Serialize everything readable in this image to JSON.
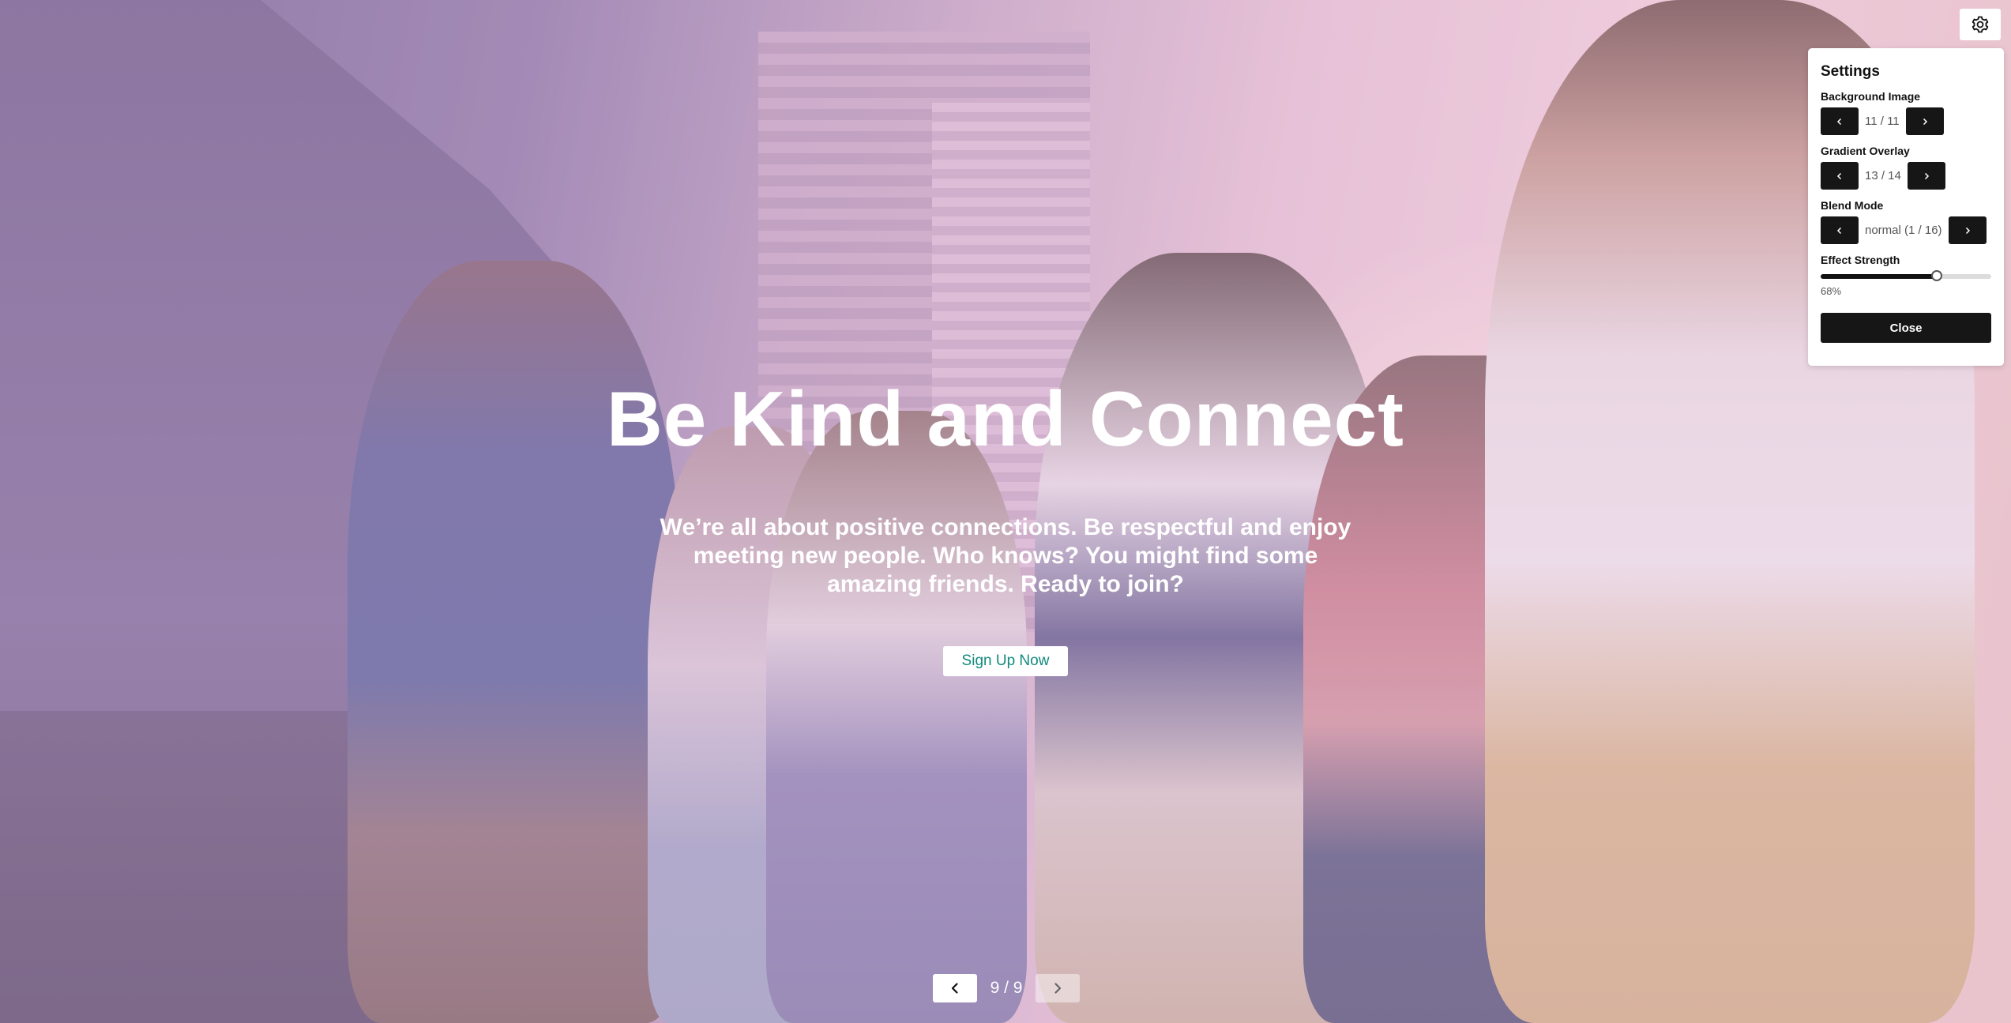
{
  "hero": {
    "title": "Be Kind and Connect",
    "subtitle": "We’re all about positive connections. Be respectful and enjoy meeting new people. Who knows? You might find some amazing friends. Ready to join?",
    "cta_label": "Sign Up Now"
  },
  "pager": {
    "prev_icon": "chevron-left-icon",
    "count": "9 / 9",
    "next_icon": "chevron-right-icon"
  },
  "settings_button": {
    "icon": "gear-icon"
  },
  "settings": {
    "title": "Settings",
    "background_image": {
      "label": "Background Image",
      "value": "11 / 11"
    },
    "gradient_overlay": {
      "label": "Gradient Overlay",
      "value": "13 / 14"
    },
    "blend_mode": {
      "label": "Blend Mode",
      "value": "normal (1 / 16)"
    },
    "effect_strength": {
      "label": "Effect Strength",
      "value_text": "68%",
      "value": 0.68
    },
    "close_label": "Close"
  },
  "colors": {
    "cta_text": "#118a7e",
    "dark_button": "#161616"
  }
}
